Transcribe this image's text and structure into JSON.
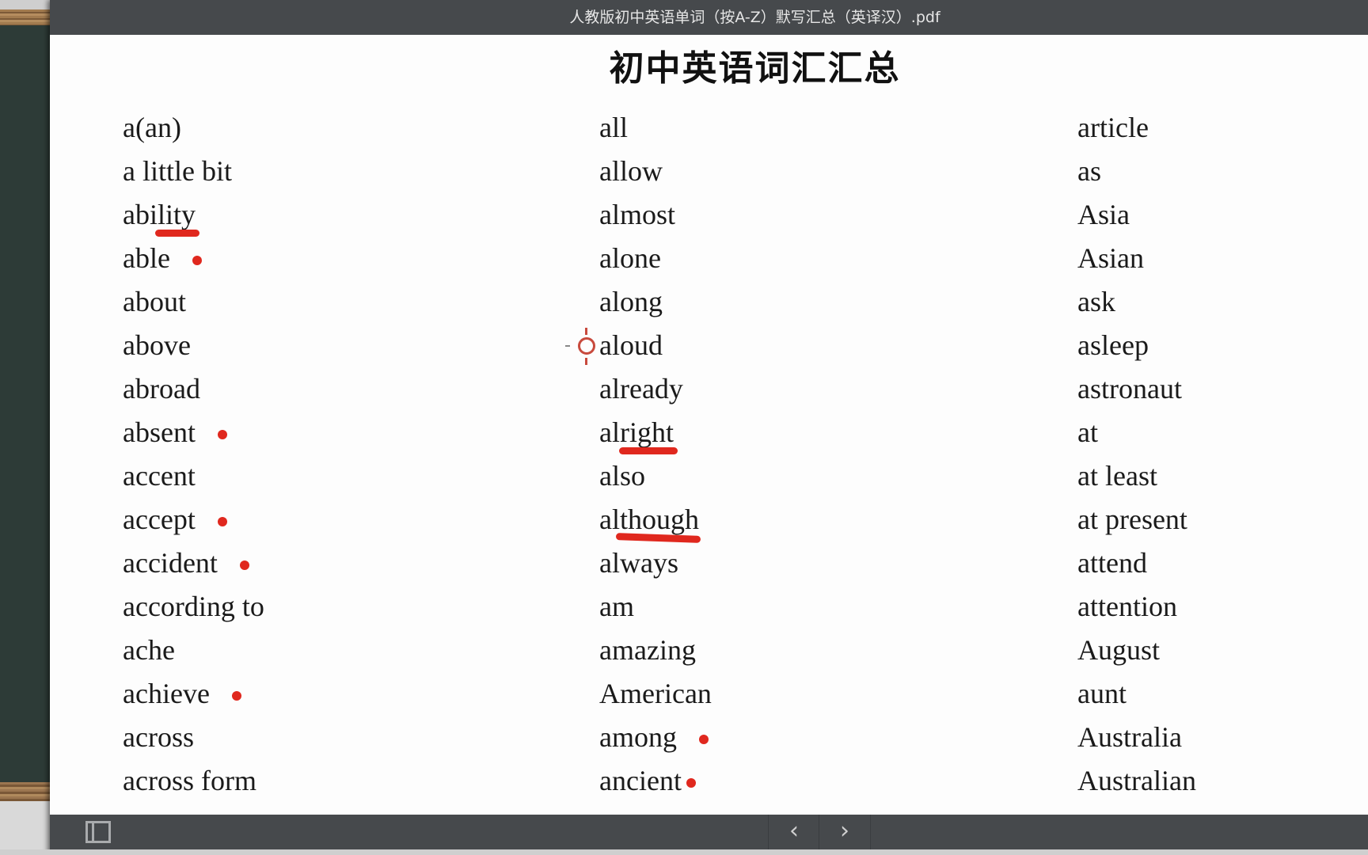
{
  "window": {
    "title": "人教版初中英语单词（按A-Z）默写汇总（英译汉）.pdf"
  },
  "document": {
    "heading": "初中英语词汇汇总",
    "columns": [
      {
        "words": [
          {
            "text": "a(an)"
          },
          {
            "text": "a little bit"
          },
          {
            "text": "ability",
            "annotation": "underline"
          },
          {
            "text": "able",
            "annotation": "dot"
          },
          {
            "text": "about"
          },
          {
            "text": "above"
          },
          {
            "text": "abroad"
          },
          {
            "text": "absent",
            "annotation": "dot"
          },
          {
            "text": "accent"
          },
          {
            "text": "accept",
            "annotation": "dot"
          },
          {
            "text": "accident",
            "annotation": "dot"
          },
          {
            "text": "according to"
          },
          {
            "text": "ache"
          },
          {
            "text": "achieve",
            "annotation": "dot"
          },
          {
            "text": "across"
          },
          {
            "text": "across form"
          }
        ]
      },
      {
        "words": [
          {
            "text": "all"
          },
          {
            "text": "allow"
          },
          {
            "text": "almost"
          },
          {
            "text": "alone"
          },
          {
            "text": "along"
          },
          {
            "text": "aloud",
            "annotation": "cursor"
          },
          {
            "text": "already"
          },
          {
            "text": "alright",
            "annotation": "underline"
          },
          {
            "text": "also"
          },
          {
            "text": "although",
            "annotation": "underline"
          },
          {
            "text": "always"
          },
          {
            "text": "am"
          },
          {
            "text": "amazing"
          },
          {
            "text": "American"
          },
          {
            "text": "among",
            "annotation": "dot"
          },
          {
            "text": "ancient",
            "annotation": "dot"
          }
        ]
      },
      {
        "words": [
          {
            "text": "article"
          },
          {
            "text": "as"
          },
          {
            "text": "Asia"
          },
          {
            "text": "Asian"
          },
          {
            "text": "ask"
          },
          {
            "text": "asleep"
          },
          {
            "text": "astronaut"
          },
          {
            "text": "at"
          },
          {
            "text": "at least"
          },
          {
            "text": "at present"
          },
          {
            "text": "attend"
          },
          {
            "text": "attention"
          },
          {
            "text": "August"
          },
          {
            "text": "aunt"
          },
          {
            "text": "Australia"
          },
          {
            "text": "Australian"
          }
        ]
      }
    ]
  },
  "toolbar": {
    "sidebar_icon": "sidebar-toggle-icon",
    "prev_label": "‹",
    "next_label": "›"
  },
  "colors": {
    "annotation": "#e0281e",
    "chrome": "#46494c"
  }
}
